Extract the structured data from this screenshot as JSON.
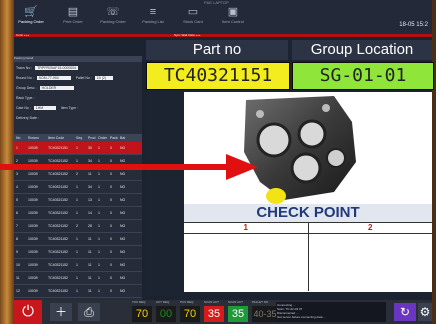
{
  "window": {
    "title": "P&E LAPTOP"
  },
  "toolbar": {
    "items": [
      {
        "label": "Packing Order",
        "icon": "cart-icon"
      },
      {
        "label": "Print Order",
        "icon": "document-icon"
      },
      {
        "label": "Packing Order",
        "icon": "phone-icon"
      },
      {
        "label": "Packing List",
        "icon": "list-icon"
      },
      {
        "label": "Stock Card",
        "icon": "card-icon"
      },
      {
        "label": "Item Control",
        "icon": "box-icon"
      }
    ],
    "clock": "18-05 15:2"
  },
  "statusbar": {
    "left": "Conn +++",
    "mid": "Sync Wait Data +++"
  },
  "order": {
    "header": "Packing Detail",
    "fields": [
      {
        "label": "Trans No :",
        "value": "TRPPR05AF15-0000004"
      },
      {
        "label": "Round No :",
        "value": "SOM-77-904",
        "label2": "Pallet No :",
        "value2": "10 (2)"
      },
      {
        "label": "Group Desc :",
        "value": "HOLDER"
      },
      {
        "label": "Rack Type :",
        "value": ""
      },
      {
        "label": "Cate No :",
        "value": "1HM",
        "label2": "Item Type :",
        "value2": ""
      },
      {
        "label": "Delivery Date :",
        "value": ""
      }
    ]
  },
  "table": {
    "columns": [
      "No",
      "Rowno",
      "Item Code",
      "Seq",
      "Prod",
      "Order",
      "Pack",
      "Bal"
    ],
    "rows": [
      [
        "1",
        "10039",
        "TC40321151",
        "1",
        "30",
        "1",
        "0",
        "NG"
      ],
      [
        "2",
        "10039",
        "TC40321152",
        "1",
        "34",
        "1",
        "0",
        "NG"
      ],
      [
        "3",
        "10039",
        "TC40321152",
        "2",
        "11",
        "1",
        "0",
        "NG"
      ],
      [
        "4",
        "10039",
        "TC40321152",
        "1",
        "34",
        "1",
        "0",
        "NG"
      ],
      [
        "5",
        "10039",
        "TC40321152",
        "1",
        "13",
        "1",
        "0",
        "NG"
      ],
      [
        "6",
        "10039",
        "TC40321152",
        "1",
        "14",
        "1",
        "0",
        "NG"
      ],
      [
        "7",
        "10039",
        "TC40321152",
        "2",
        "28",
        "1",
        "0",
        "NG"
      ],
      [
        "8",
        "10039",
        "TC40321152",
        "1",
        "11",
        "1",
        "0",
        "NG"
      ],
      [
        "9",
        "10039",
        "TC40321152",
        "1",
        "11",
        "1",
        "0",
        "NG"
      ],
      [
        "10",
        "10039",
        "TC40321152",
        "1",
        "11",
        "1",
        "0",
        "NG"
      ],
      [
        "11",
        "10039",
        "TC40321152",
        "1",
        "11",
        "1",
        "0",
        "NG"
      ],
      [
        "12",
        "10039",
        "TC40321152",
        "1",
        "11",
        "1",
        "0",
        "NG"
      ]
    ]
  },
  "part": {
    "part_no_label": "Part no",
    "group_label": "Group Location",
    "part_no": "TC40321151",
    "group_location": "SG-01-01"
  },
  "checkpoint": {
    "title": "CHECK POINT",
    "col1": "1",
    "col2": "2"
  },
  "bottom": {
    "counters": [
      {
        "label": "TOK REQ",
        "value": "70",
        "color": "#f5d200",
        "bg": "#1a1a1a"
      },
      {
        "label": "ACT REQ",
        "value": "00",
        "color": "#1e8a1e",
        "bg": "#1a1a1a"
      },
      {
        "label": "PCS REQ",
        "value": "70",
        "color": "#f5d200",
        "bg": "#1a1a1a"
      },
      {
        "label": "SCAN ACT",
        "value": "35",
        "color": "#ffffff",
        "bg": "#d41c1c"
      },
      {
        "label": "SCAN ACT",
        "value": "35",
        "color": "#ffffff",
        "bg": "#1e9a3a"
      },
      {
        "label": "PALLET NO",
        "value": "40-35",
        "color": "#7a7a7a",
        "bg": "#1a1a1a"
      }
    ],
    "messages": [
      "Connecting ...",
      "Scan: TC-02-03 07",
      "Disconnected ...",
      "Get server before connecting data ..."
    ]
  },
  "colors": {
    "accent_red": "#c0141a",
    "part_yellow": "#f3ec1e",
    "group_green": "#8fe53a",
    "checkpoint_blue": "#203a7a"
  }
}
